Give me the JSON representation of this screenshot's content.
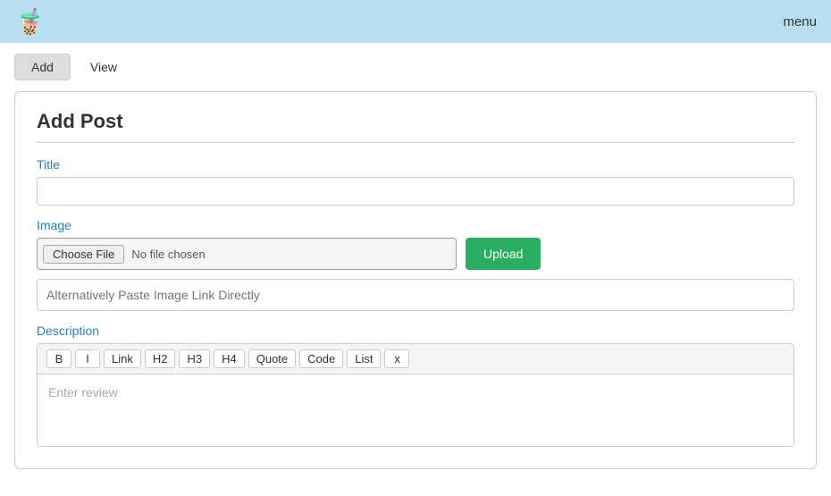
{
  "header": {
    "logo": "🧋",
    "menu_label": "menu"
  },
  "nav": {
    "tabs": [
      {
        "id": "add",
        "label": "Add",
        "active": true
      },
      {
        "id": "view",
        "label": "View",
        "active": false
      }
    ]
  },
  "form": {
    "title": "Add Post",
    "fields": {
      "title": {
        "label": "Title",
        "placeholder": "",
        "value": ""
      },
      "image": {
        "label": "Image",
        "choose_file_label": "Choose File",
        "no_file_text": "No file chosen",
        "upload_label": "Upload",
        "link_placeholder": "Alternatively Paste Image Link Directly"
      },
      "description": {
        "label": "Description",
        "placeholder": "Enter review",
        "toolbar_buttons": [
          "B",
          "I",
          "Link",
          "H2",
          "H3",
          "H4",
          "Quote",
          "Code",
          "List",
          "x"
        ]
      }
    }
  }
}
